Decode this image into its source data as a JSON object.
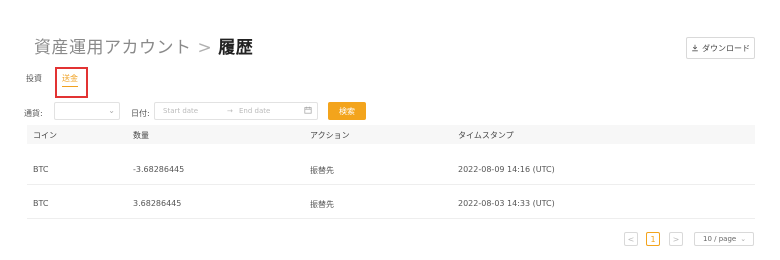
{
  "header": {
    "title_parent": "資産運用アカウント",
    "separator": ">",
    "title_current": "履歴",
    "download_label": "ダウンロード"
  },
  "tabs": [
    {
      "label": "投資",
      "active": false
    },
    {
      "label": "送金",
      "active": true
    }
  ],
  "filters": {
    "type_label": "通貨:",
    "date_label": "日付:",
    "start_placeholder": "Start date",
    "range_arrow": "→",
    "end_placeholder": "End date",
    "search_label": "検索"
  },
  "table": {
    "columns": [
      "コイン",
      "数量",
      "アクション",
      "タイムスタンプ"
    ],
    "rows": [
      {
        "coin": "BTC",
        "amount": "-3.68286445",
        "action": "振替先",
        "timestamp": "2022-08-09 14:16 (UTC)"
      },
      {
        "coin": "BTC",
        "amount": "3.68286445",
        "action": "振替先",
        "timestamp": "2022-08-03 14:33 (UTC)"
      }
    ]
  },
  "pagination": {
    "prev": "<",
    "current_page": "1",
    "next": ">",
    "page_size": "10 / page"
  },
  "colors": {
    "accent": "#f3a41c",
    "highlight": "#e23333"
  }
}
